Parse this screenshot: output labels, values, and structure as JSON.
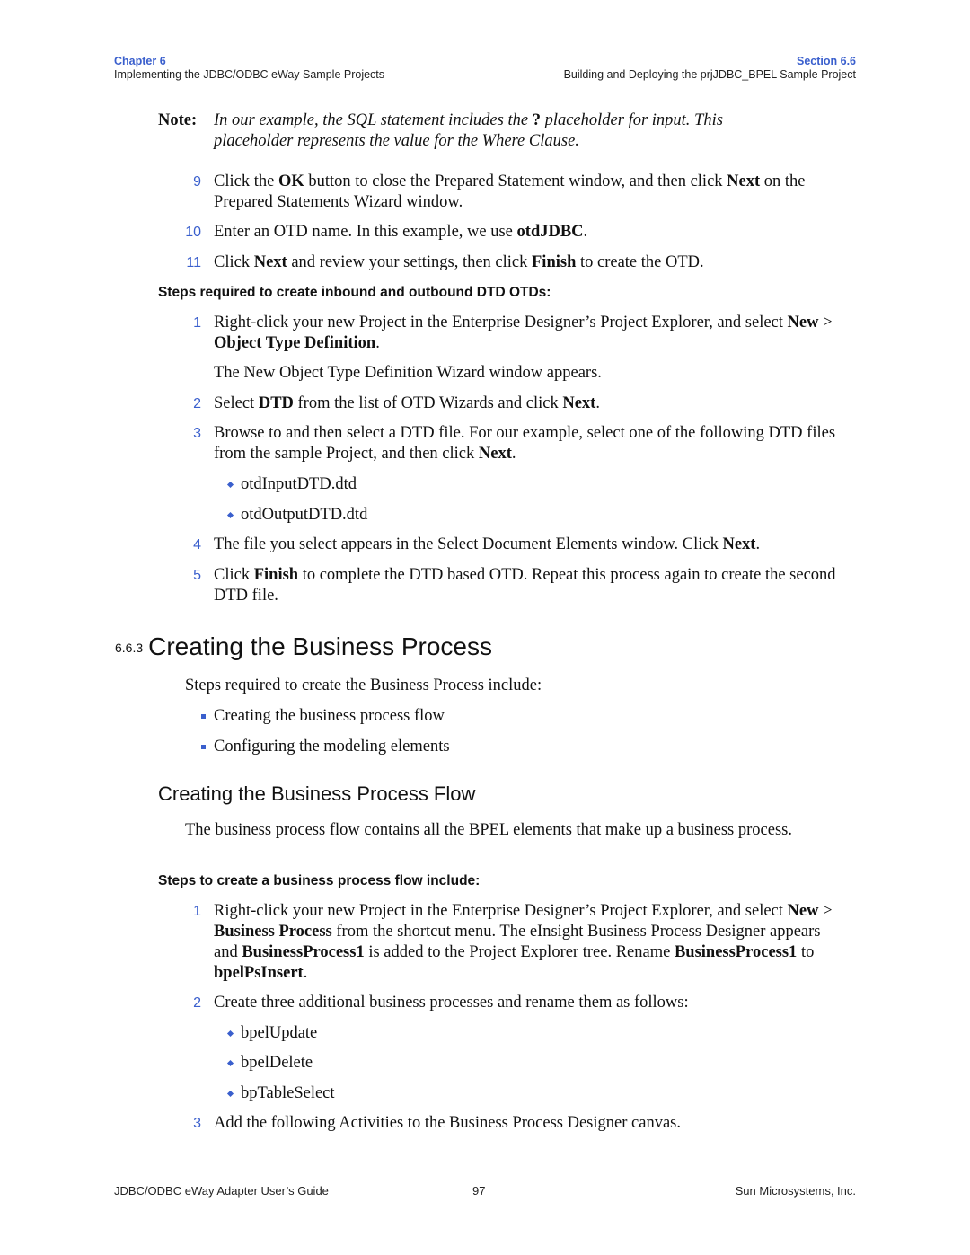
{
  "header": {
    "chapter_label": "Chapter 6",
    "chapter_title": "Implementing the JDBC/ODBC eWay Sample Projects",
    "section_label": "Section 6.6",
    "section_title": "Building and Deploying the prjJDBC_BPEL Sample Project"
  },
  "note": {
    "label": "Note:",
    "line1_pre": "In our example, the SQL statement includes the ",
    "line1_bold": "?",
    "line1_post": " placeholder for input. This",
    "line2": "placeholder represents the value for the Where Clause."
  },
  "steps_a": [
    {
      "num": "9",
      "p1": "Click the ",
      "b1": "OK",
      "p2": " button to close the Prepared Statement window, and then click ",
      "b2": "Next",
      "p3": " on the Prepared Statements Wizard window."
    },
    {
      "num": "10",
      "p1": "Enter an OTD name. In this example, we use ",
      "b1": "otdJDBC",
      "p2": "."
    },
    {
      "num": "11",
      "p1": "Click ",
      "b1": "Next",
      "p2": " and review your settings, then click ",
      "b2": "Finish",
      "p3": " to create the OTD."
    }
  ],
  "dtd_section": {
    "heading": "Steps required to create inbound and outbound DTD OTDs:",
    "steps": [
      {
        "num": "1",
        "p1": "Right-click your new Project in the Enterprise Designer’s Project Explorer, and select ",
        "b1": "New",
        "p2": " > ",
        "b2": "Object Type Definition",
        "p3": "."
      },
      {
        "num": "2",
        "p1": "Select ",
        "b1": "DTD",
        "p2": " from the list of OTD Wizards and click ",
        "b2": "Next",
        "p3": "."
      },
      {
        "num": "3",
        "p1": "Browse to and then select a DTD file. For our example, select one of the following DTD files from the sample Project, and then click ",
        "b1": "Next",
        "p2": "."
      },
      {
        "num": "4",
        "p1": "The file you select appears in the Select Document Elements window. Click ",
        "b1": "Next",
        "p2": "."
      },
      {
        "num": "5",
        "p1": "Click ",
        "b1": "Finish",
        "p2": " to complete the DTD based OTD. Repeat this process again to create the second DTD file."
      }
    ],
    "step1_result": "The New Object Type Definition Wizard window appears.",
    "dtd_files": [
      "otdInputDTD.dtd",
      "otdOutputDTD.dtd"
    ]
  },
  "section_663": {
    "number": "6.6.3",
    "title": "Creating the Business Process",
    "intro": "Steps required to create the Business Process include:",
    "items": [
      "Creating the business process flow",
      "Configuring the modeling elements"
    ]
  },
  "flow_section": {
    "title": "Creating the Business Process Flow",
    "intro": "The business process flow contains all the BPEL elements that make up a business process.",
    "steps_heading": "Steps to create a business process flow include:",
    "steps": [
      {
        "num": "1",
        "p1": "Right-click your new Project in the Enterprise Designer’s Project Explorer, and select ",
        "b1": "New",
        "p2": " > ",
        "b2": "Business Process",
        "p3": " from the shortcut menu. The eInsight Business Process Designer appears and ",
        "b3": "BusinessProcess1",
        "p4": " is added to the Project Explorer tree. Rename ",
        "b4": "BusinessProcess1",
        "p5": " to ",
        "b5": "bpelPsInsert",
        "p6": "."
      },
      {
        "num": "2",
        "p1": "Create three additional business processes and rename them as follows:"
      },
      {
        "num": "3",
        "p1": "Add the following Activities to the Business Process Designer canvas."
      }
    ],
    "process_names": [
      "bpelUpdate",
      "bpelDelete",
      "bpTableSelect"
    ]
  },
  "footer": {
    "guide_title": "JDBC/ODBC eWay Adapter User’s Guide",
    "page_number": "97",
    "company": "Sun Microsystems, Inc."
  },
  "colors": {
    "accent": "#3a5fcd",
    "text": "#111111"
  }
}
